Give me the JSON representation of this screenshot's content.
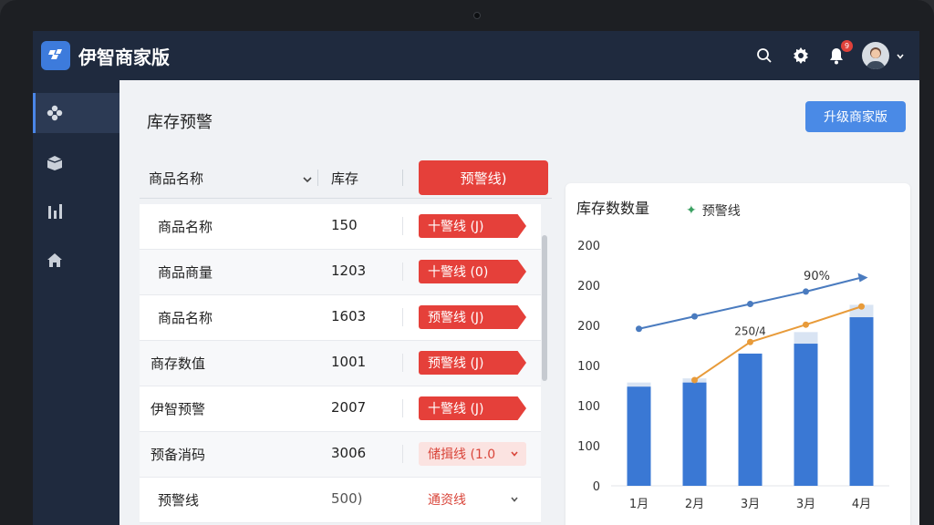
{
  "app": {
    "title": "伊智商家版"
  },
  "header": {
    "notification_count": "9"
  },
  "page": {
    "title": "库存预警",
    "upgrade_label": "升级商家版"
  },
  "table": {
    "headers": {
      "name": "商品名称",
      "stock": "库存",
      "warning": "预警线)"
    },
    "rows": [
      {
        "name": "商品名称",
        "stock": "150",
        "tag": "十警线 (J)",
        "style": "solid"
      },
      {
        "name": "商品商量",
        "stock": "1203",
        "tag": "十警线 (0)",
        "style": "solid"
      },
      {
        "name": "商品名称",
        "stock": "1603",
        "tag": "预警线 (J)",
        "style": "solid"
      },
      {
        "name": "商存数值",
        "stock": "1001",
        "tag": "预警线 (J)",
        "style": "solid"
      },
      {
        "name": "伊智预警",
        "stock": "2007",
        "tag": "十警线 (J)",
        "style": "solid"
      },
      {
        "name": "预备消码",
        "stock": "3006",
        "tag": "储揖线 (1.0",
        "style": "light"
      },
      {
        "name": "预警线",
        "stock": "500)",
        "tag": "通资线",
        "style": "plain"
      }
    ]
  },
  "chart_data": {
    "type": "bar",
    "title": "库存数数量",
    "categories": [
      "1月",
      "2月",
      "3月",
      "3月",
      "4月"
    ],
    "y_tick_labels": [
      "0",
      "100",
      "100",
      "100",
      "200",
      "200",
      "200"
    ],
    "ylim": [
      0,
      300
    ],
    "series": [
      {
        "type": "bar",
        "values": [
          120,
          125,
          160,
          172,
          204
        ]
      },
      {
        "type": "bar-top",
        "values": [
          5,
          5,
          0,
          14,
          15
        ]
      },
      {
        "type": "line",
        "color": "#4a7bbf",
        "values": [
          190,
          205,
          220,
          235,
          252
        ]
      },
      {
        "name": "预警线",
        "type": "line",
        "color": "#e89b3a",
        "values": [
          null,
          128,
          174,
          195,
          217
        ]
      }
    ],
    "annotations": [
      "90%",
      "250/4"
    ],
    "colors": {
      "bar": "#3a78d4",
      "bar_top": "#d9e4f3"
    }
  }
}
